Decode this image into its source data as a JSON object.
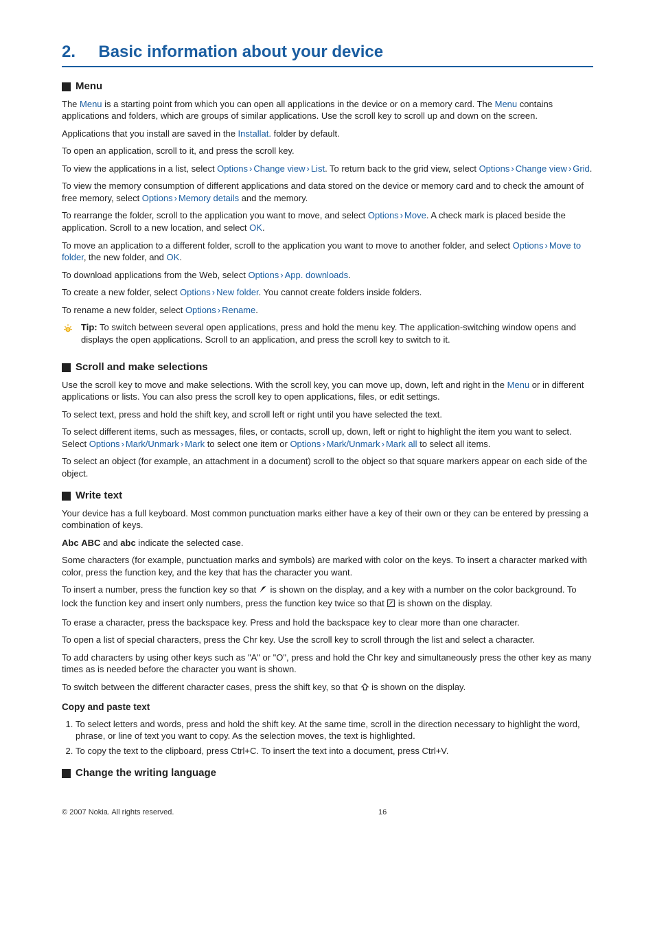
{
  "chapter": {
    "num": "2.",
    "title": "Basic information about your device"
  },
  "menu": {
    "heading": "Menu",
    "p1a": "The ",
    "p1_link1": "Menu",
    "p1b": " is a starting point from which you can open all applications in the device or on a memory card. The ",
    "p1_link2": "Menu",
    "p1c": " contains applications and folders, which are groups of similar applications. Use the scroll key to scroll up and down on the screen.",
    "p2a": "Applications that you install are saved in the ",
    "p2_link": "Installat.",
    "p2b": " folder by default.",
    "p3": "To open an application, scroll to it, and press the scroll key.",
    "p4a": "To view the applications in a list, select ",
    "p4_o1": "Options",
    "p4_cv1": "Change view",
    "p4_list": "List",
    "p4b": ". To return back to the grid view, select ",
    "p4_o2": "Options",
    "p4_cv2": "Change view",
    "p4_grid": "Grid",
    "p4c": ".",
    "p5a": "To view the memory consumption of different applications and data stored on the device or memory card and to check the amount of free memory, select ",
    "p5_o": "Options",
    "p5_md": "Memory details",
    "p5b": " and the memory.",
    "p6a": "To rearrange the folder, scroll to the application you want to move, and select ",
    "p6_o": "Options",
    "p6_move": "Move",
    "p6b": ". A check mark is placed beside the application. Scroll to a new location, and select ",
    "p6_ok": "OK",
    "p6c": ".",
    "p7a": "To move an application to a different folder, scroll to the application you want to move to another folder, and select ",
    "p7_o": "Options",
    "p7_mtf": "Move to folder",
    "p7b": ", the new folder, and ",
    "p7_ok": "OK",
    "p7c": ".",
    "p8a": "To download applications from the Web, select ",
    "p8_o": "Options",
    "p8_ad": "App. downloads",
    "p8b": ".",
    "p9a": "To create a new folder, select ",
    "p9_o": "Options",
    "p9_nf": "New folder",
    "p9b": ". You cannot create folders inside folders.",
    "p10a": "To rename a new folder, select ",
    "p10_o": "Options",
    "p10_rn": "Rename",
    "p10b": ".",
    "tip_label": "Tip:",
    "tip_text": " To switch between several open applications, press and hold the menu key. The application-switching window opens and displays the open applications. Scroll to an application, and press the scroll key to switch to it."
  },
  "scroll": {
    "heading": "Scroll and make selections",
    "p1a": "Use the scroll key to move and make selections. With the scroll key, you can move up, down, left and right in the ",
    "p1_link": "Menu",
    "p1b": " or in different applications or lists. You can also press the scroll key to open applications, files, or edit settings.",
    "p2": "To select text, press and hold the shift key, and scroll left or right until you have selected the text.",
    "p3a": "To select different items, such as messages, files, or contacts, scroll up, down, left or right to highlight the item you want to select. Select ",
    "p3_o1": "Options",
    "p3_mu1": "Mark/Unmark",
    "p3_mark": "Mark",
    "p3b": " to select one item or ",
    "p3_o2": "Options",
    "p3_mu2": "Mark/Unmark",
    "p3_markall": "Mark all",
    "p3c": " to select all items.",
    "p4": "To select an object (for example, an attachment in a document) scroll to the object so that square markers appear on each side of the object."
  },
  "write": {
    "heading": "Write text",
    "p1": "Your device has a full keyboard. Most common punctuation marks either have a key of their own or they can be entered by pressing a combination of keys.",
    "case_abc_up": "Abc",
    "case_abcup2": "ABC",
    "case_and": " and ",
    "case_abc_low": "abc",
    "case_tail": " indicate the selected case.",
    "p3": "Some characters (for example, punctuation marks and symbols) are marked with color on the keys. To insert a character marked with color, press the function key, and the key that has the character you want.",
    "p4a": "To insert a number, press the function key so that ",
    "p4b": " is shown on the display, and a key with a number on the color background. To lock the function key and insert only numbers, press the function key twice so that ",
    "p4c": " is shown on the display.",
    "p5": "To erase a character, press the backspace key. Press and hold the backspace key to clear more than one character.",
    "p6": "To open a list of special characters, press the Chr key. Use the scroll key to scroll through the list and select a character.",
    "p7": "To add characters by using other keys such as \"A\" or \"O\", press and hold the Chr key and simultaneously press the other key as many times as is needed before the character you want is shown.",
    "p8a": "To switch between the different character cases, press the shift key, so that ",
    "p8b": " is shown on the display.",
    "copy_heading": "Copy and paste text",
    "copy_step1": "To select letters and words, press and hold the shift key. At the same time, scroll in the direction necessary to highlight the word, phrase, or line of text you want to copy. As the selection moves, the text is highlighted.",
    "copy_step2": "To copy the text to the clipboard, press Ctrl+C. To insert the text into a document, press Ctrl+V."
  },
  "change_lang": {
    "heading": "Change the writing language"
  },
  "footer": {
    "copyright": "© 2007 Nokia. All rights reserved.",
    "page": "16"
  }
}
